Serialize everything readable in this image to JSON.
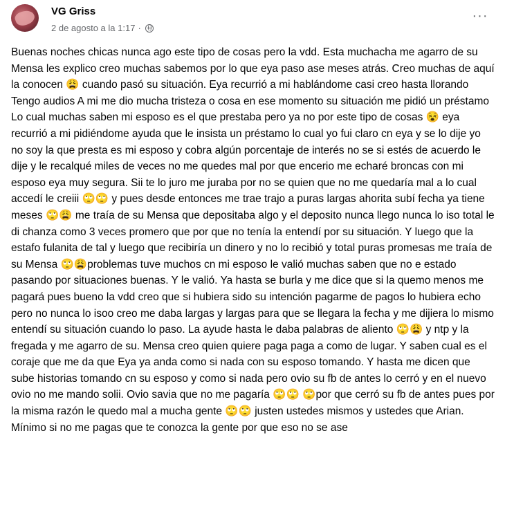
{
  "post": {
    "author": "VG Griss",
    "timestamp": "2 de agosto a la 1:17",
    "separator": "·",
    "privacy_icon": "globe-icon",
    "more_icon": "more-options-icon",
    "text": "Buenas noches chicas nunca ago este tipo de cosas pero la vdd.  Esta muchacha me agarro de su Mensa les explico creo muchas sabemos por lo que eya paso ase meses atrás.   Creo muchas de aquí la conocen 😩  cuando pasó su situación.  Eya recurrió a mi  hablándome casi creo hasta llorando   Tengo audios   A mi me dio mucha tristeza o cosa en ese momento su situación me pidió un préstamo   Lo cual muchas saben mi esposo es el que prestaba pero ya no por este tipo de cosas 😵 eya recurrió a mi pidiéndome ayuda que le insista un préstamo lo cual yo fui claro cn eya y se lo dije yo no soy la que presta es mi esposo y cobra algún porcentaje de interés  no se si estés de acuerdo le dije y le  recalqué miles de veces no me quedes mal por que encerio me echaré broncas con mi esposo eya muy segura. Sii te lo juro me juraba por no se quien que no me quedaría mal a lo cual accedí le creiii 🙄🙄 y pues desde entonces me trae  trajo a puras largas ahorita subí fecha ya tiene meses 🙄😩 me traía de su Mensa que depositaba algo y el deposito nunca llego nunca lo iso total le di chanza como 3 veces promero que por que no tenía la entendí por su situación.  Y luego que la estafo fulanita de tal y luego que recibiría un dinero y no lo recibió y total puras promesas  me traía de su Mensa 🙄😩problemas tuve muchos cn mi esposo  le valió muchas saben que no e estado pasando por situaciones buenas. Y le valió. Ya hasta se burla y me dice que si la quemo menos me pagará pues bueno la vdd  creo que si hubiera sido su intención pagarme de pagos lo hubiera echo pero no nunca lo isoo  creo me daba largas y largas para que se llegara la fecha y me dijiera lo mismo  entendí su situación cuando lo paso.   La ayude hasta le daba palabras de aliento 🙄😩 y ntp y la fregada y me agarro de su. Mensa creo quien quiere paga paga  a como de lugar. Y saben cual es el coraje que me da que Eya ya anda como si nada  con su esposo tomando. Y hasta me dicen que sube historias tomando cn su esposo  y como si nada pero ovio su fb de antes lo cerró y en el nuevo ovio   no me mando solii. Ovio savia que no me pagaría 🙄🙄 🙄por que cerró su fb de antes pues por la misma razón le quedo mal a mucha gente 🙄🙄 justen ustedes mismos y ustedes que Arian.  Mínimo si no me pagas que te conozca la gente por que eso no se ase"
  }
}
